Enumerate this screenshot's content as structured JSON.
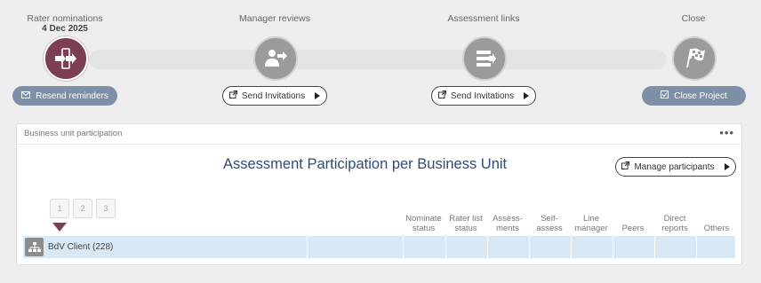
{
  "steps": [
    {
      "title": "Rater nominations",
      "date": "4 Dec 2025",
      "icon": "nomination-arrows-icon",
      "state": "active",
      "button": "Resend reminders",
      "button_icon": "mail-icon"
    },
    {
      "title": "Manager reviews",
      "date": "",
      "icon": "manager-review-icon",
      "state": "inactive",
      "button": "Send Invitations",
      "button_icon": "external-link-icon"
    },
    {
      "title": "Assessment links",
      "date": "",
      "icon": "assessment-list-icon",
      "state": "inactive",
      "button": "Send Invitations",
      "button_icon": "external-link-icon"
    },
    {
      "title": "Close",
      "date": "",
      "icon": "checkered-flag-icon",
      "state": "inactive",
      "button": "Close Project",
      "button_icon": "checkbox-icon"
    }
  ],
  "card": {
    "header": "Business unit participation",
    "menu": "•••",
    "title": "Assessment Participation per Business Unit",
    "manage_button": "Manage participants",
    "levels": [
      "1",
      "2",
      "3"
    ],
    "columns": [
      {
        "line1": "Nominate",
        "line2": "status"
      },
      {
        "line1": "Rater list",
        "line2": "status"
      },
      {
        "line1": "Assess-",
        "line2": "ments"
      },
      {
        "line1": "Self-",
        "line2": "assess"
      },
      {
        "line1": "Line",
        "line2": "manager"
      },
      {
        "line1": "",
        "line2": "Peers"
      },
      {
        "line1": "Direct",
        "line2": "reports"
      },
      {
        "line1": "",
        "line2": "Others"
      }
    ],
    "rows": [
      {
        "label": "BdV Client (228)"
      }
    ]
  },
  "colors": {
    "accent": "#7b3e55",
    "button_fill": "#7e8fa8",
    "title": "#2d4b7a",
    "row_bg": "#d7e8f6"
  }
}
